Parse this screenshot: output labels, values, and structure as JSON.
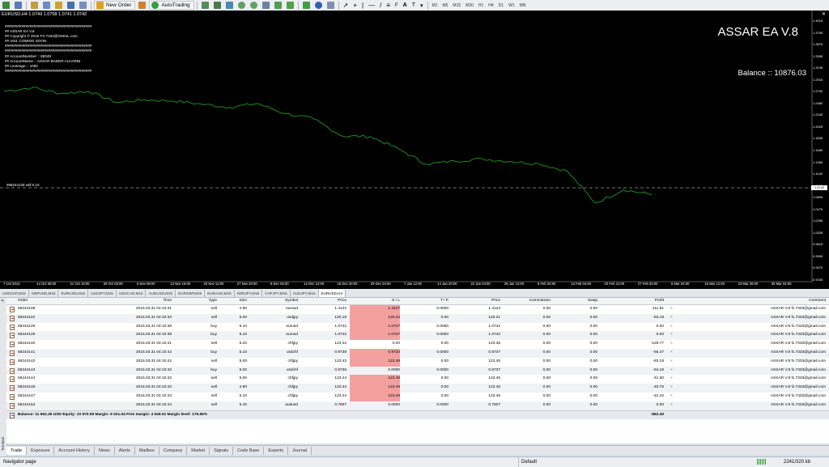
{
  "toolbar": {
    "new_order_label": "New Order",
    "autotrading_label": "AutoTrading",
    "timeframes": [
      "M1",
      "M5",
      "M15",
      "M30",
      "H1",
      "H4",
      "D1",
      "W1",
      "MN"
    ]
  },
  "chart": {
    "title": "EURUSD,H4  1.0749 1.0758 1.0741 1.0742",
    "ea_info": [
      "##########################################",
      "## ASSAR EA V.8",
      "## Copyright © 2015 FX.7333@GMAIL.com",
      "## Visit: COMING SOON",
      "##########################################",
      "##########################################",
      "## AccountNumber :: 89349",
      "## AccountName :: ASSAR BADER ALHARBI",
      "## Leverage :: 1000",
      "##########################################"
    ],
    "brand": "ASSAR EA V.8",
    "balance": "Balance :: 10876.03",
    "order_line_label": "#58244128 sell 5.10",
    "current_price": "1.0742",
    "line_color": "#1a8a1a",
    "y_ticks": [
      "1.4015",
      "1.3795",
      "1.3575",
      "1.3355",
      "1.3135",
      "1.2915",
      "1.2700",
      "1.2480",
      "1.2245",
      "1.2025",
      "1.1805",
      "1.1580",
      "1.1360",
      "1.1140",
      "1.0920",
      "1.0695",
      "1.0475",
      "1.0255",
      "1.0035",
      "0.9815",
      "0.9590",
      "0.9370",
      "0.9150"
    ],
    "x_ticks": [
      "7 Oct 2014",
      "14 Oct 08:00",
      "21 Oct 16:00",
      "29 Oct 00:00",
      "5 Nov 08:00",
      "12 Nov 16:00",
      "20 Nov 12:00",
      "27 Nov 20:00",
      "5 Dec 04:00",
      "12 Dec 12:00",
      "19 Dec 20:00",
      "29 Dec 04:00",
      "7 Jan 12:00",
      "14 Jan 20:00",
      "22 Jan 04:00",
      "29 Jan 12:00",
      "5 Feb 20:00",
      "13 Feb 04:00",
      "20 Feb 12:00",
      "27 Feb 20:00",
      "9 Mar 04:00",
      "16 Mar 12:00",
      "23 Mar 20:00",
      "30 Mar 04:00"
    ]
  },
  "chart_data": {
    "type": "line",
    "title": "EURUSD,H4",
    "x": [
      "7 Oct 2014",
      "14 Oct",
      "21 Oct",
      "29 Oct",
      "5 Nov",
      "12 Nov",
      "20 Nov",
      "27 Nov",
      "5 Dec",
      "12 Dec",
      "19 Dec",
      "29 Dec",
      "7 Jan",
      "14 Jan",
      "22 Jan",
      "29 Jan",
      "5 Feb",
      "13 Feb",
      "20 Feb",
      "27 Feb",
      "9 Mar",
      "16 Mar",
      "23 Mar",
      "31 Mar"
    ],
    "series": [
      {
        "values": [
          1.268,
          1.275,
          1.264,
          1.268,
          1.247,
          1.252,
          1.25,
          1.244,
          1.238,
          1.245,
          1.226,
          1.216,
          1.184,
          1.183,
          1.16,
          1.131,
          1.137,
          1.141,
          1.136,
          1.132,
          1.118,
          1.058,
          1.083,
          1.074
        ]
      }
    ],
    "ylim": [
      0.915,
      1.4015
    ],
    "grid": false
  },
  "symbol_tabs": [
    "USDCHF,M15",
    "GBPUSD,M15",
    "EURUSD,M15",
    "USDJPY,M15",
    "USDCAD,M15",
    "AUDUSD,M15",
    "EURGBP,M15",
    "EURAUD,M15",
    "NZDJPY,M15",
    "CHFJPY,M15",
    "AUDJPY,M15",
    "EURUSD,H4"
  ],
  "trade_table": {
    "headers": [
      "Order",
      "Time",
      "Type",
      "Size",
      "Symbol",
      "Price",
      "S / L",
      "T / P",
      "Price",
      "Commission",
      "Swap",
      "Profit",
      "Comment"
    ],
    "rows": [
      {
        "order": "58244109",
        "time": "2015.03.31 04:10:31",
        "type": "sell",
        "size": "4.90",
        "symbol": "euraud",
        "price": "1.4122",
        "sl": "1.4127",
        "tp": "0.0000",
        "cur": "1.4124",
        "commission": "0.00",
        "swap": "0.00",
        "profit": "-111.81",
        "comment": "ASSAR V.8 fx.7333@gmail.com",
        "sl_red": true
      },
      {
        "order": "58244110",
        "time": "2015.03.31 04:10:33",
        "type": "sell",
        "size": "5.00",
        "symbol": "usdjpy",
        "price": "120.19",
        "sl": "120.24",
        "tp": "0.00",
        "cur": "120.21",
        "commission": "0.00",
        "swap": "0.00",
        "profit": "-83.19",
        "comment": "ASSAR V.8 fx.7333@gmail.com",
        "sl_red": true
      },
      {
        "order": "58244126",
        "time": "2015.03.31 04:10:38",
        "type": "buy",
        "size": "5.10",
        "symbol": "eurusd",
        "price": "1.0742",
        "sl": "1.0737",
        "tp": "0.0000",
        "cur": "1.0742",
        "commission": "0.00",
        "swap": "0.00",
        "profit": "0.00",
        "comment": "ASSAR V.8 fx.7333@gmail.com",
        "sl_red": true
      },
      {
        "order": "58244128",
        "time": "2015.03.31 04:10:38",
        "type": "buy",
        "size": "5.10",
        "symbol": "eurusd",
        "price": "1.0742",
        "sl": "1.0737",
        "tp": "0.0000",
        "cur": "1.0742",
        "commission": "0.00",
        "swap": "0.00",
        "profit": "0.00",
        "comment": "ASSAR V.8 fx.7333@gmail.com",
        "sl_red": true
      },
      {
        "order": "58244140",
        "time": "2015.03.31 04:10:41",
        "type": "sell",
        "size": "5.20",
        "symbol": "chfjpy",
        "price": "123.42",
        "sl": "0.00",
        "tp": "0.00",
        "cur": "123.45",
        "commission": "0.00",
        "swap": "0.00",
        "profit": "-129.77",
        "comment": "ASSAR V.8 fx.7333@gmail.com",
        "sl_red": false
      },
      {
        "order": "58244141",
        "time": "2015.03.31 04:10:42",
        "type": "buy",
        "size": "5.10",
        "symbol": "usdchf",
        "price": "0.9738",
        "sl": "0.9733",
        "tp": "0.0000",
        "cur": "0.9737",
        "commission": "0.00",
        "swap": "0.00",
        "profit": "-65.47",
        "comment": "ASSAR V.8 fx.7333@gmail.com",
        "sl_red": true
      },
      {
        "order": "58244142",
        "time": "2015.03.31 04:10:42",
        "type": "sell",
        "size": "5.00",
        "symbol": "chfjpy",
        "price": "123.43",
        "sl": "123.48",
        "tp": "0.00",
        "cur": "123.45",
        "commission": "0.00",
        "swap": "0.00",
        "profit": "-83.19",
        "comment": "ASSAR V.8 fx.7333@gmail.com",
        "sl_red": true
      },
      {
        "order": "58244143",
        "time": "2015.03.31 04:10:42",
        "type": "buy",
        "size": "5.00",
        "symbol": "usdchf",
        "price": "0.9738",
        "sl": "0.0000",
        "tp": "0.0000",
        "cur": "0.9737",
        "commission": "0.00",
        "swap": "0.00",
        "profit": "-64.19",
        "comment": "ASSAR V.8 fx.7333@gmail.com",
        "sl_red": false
      },
      {
        "order": "58244144",
        "time": "2015.03.31 04:10:42",
        "type": "sell",
        "size": "5.00",
        "symbol": "chfjpy",
        "price": "123.44",
        "sl": "123.49",
        "tp": "0.00",
        "cur": "123.45",
        "commission": "0.00",
        "swap": "0.00",
        "profit": "-41.60",
        "comment": "ASSAR V.8 fx.7333@gmail.com",
        "sl_red": true
      },
      {
        "order": "58244146",
        "time": "2015.03.31 04:10:42",
        "type": "sell",
        "size": "4.90",
        "symbol": "chfjpy",
        "price": "123.44",
        "sl": "123.49",
        "tp": "0.00",
        "cur": "123.45",
        "commission": "0.00",
        "swap": "0.00",
        "profit": "-40.76",
        "comment": "ASSAR V.8 fx.7333@gmail.com",
        "sl_red": true
      },
      {
        "order": "58244147",
        "time": "2015.03.31 04:10:43",
        "type": "sell",
        "size": "5.10",
        "symbol": "chfjpy",
        "price": "123.44",
        "sl": "123.49",
        "tp": "0.00",
        "cur": "123.45",
        "commission": "0.00",
        "swap": "0.00",
        "profit": "-42.42",
        "comment": "ASSAR V.8 fx.7333@gmail.com",
        "sl_red": true
      },
      {
        "order": "58244154",
        "time": "2015.03.31 04:10:44",
        "type": "sell",
        "size": "5.40",
        "symbol": "audusd",
        "price": "0.7607",
        "sl": "0.0000",
        "tp": "0.0000",
        "cur": "0.7607",
        "commission": "0.00",
        "swap": "0.00",
        "profit": "0.00",
        "comment": "ASSAR V.8 fx.7333@gmail.com",
        "sl_red": false
      }
    ],
    "summary_text": "Balance: 11 652.45 USD   Equity: 10 570.05   Margin: 6 021.04   Free margin: 4 549.01   Margin level: 175.55%",
    "summary_profit": "-662.40"
  },
  "terminal_label": "Terminal",
  "bottom_tabs": [
    "Trade",
    "Exposure",
    "Account History",
    "News",
    "Alerts",
    "Mailbox",
    "Company",
    "Market",
    "Signals",
    "Code Base",
    "Experts",
    "Journal"
  ],
  "status": {
    "left": "Navigator page",
    "profile": "Default",
    "traffic": "2241/320 kb"
  }
}
